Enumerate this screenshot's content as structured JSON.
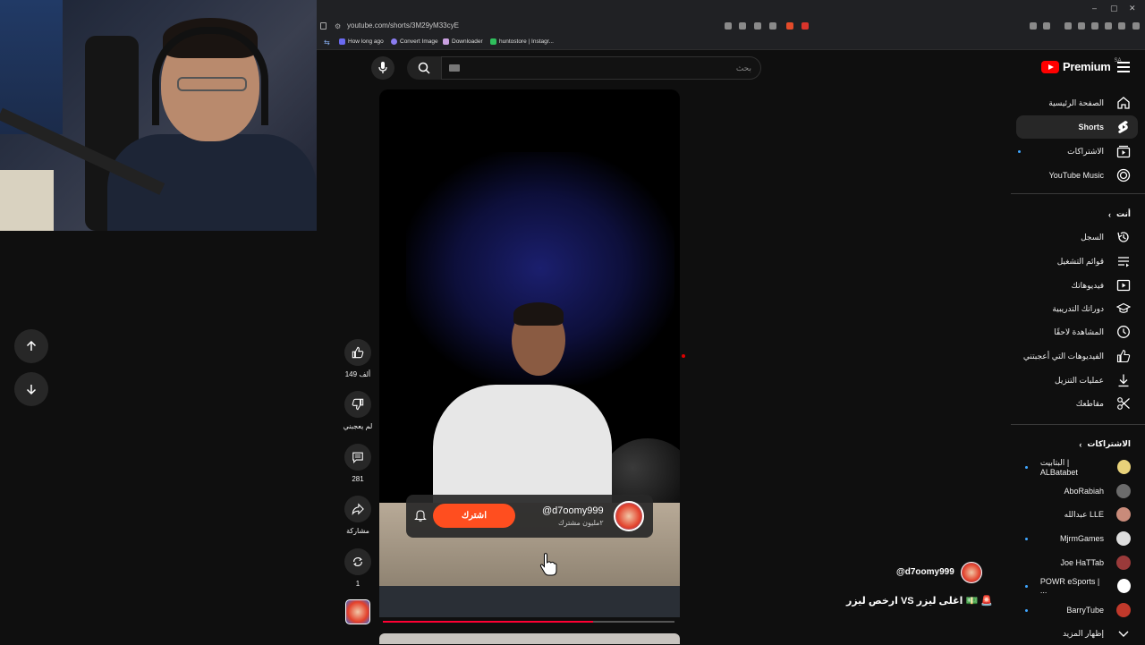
{
  "browser": {
    "url": "youtube.com/shorts/3M29yM33cyE",
    "bookmarks": [
      "How long ago",
      "Convert Image",
      "Downloader",
      "huntostore | Instagr..."
    ],
    "window_controls": [
      "–",
      "▢",
      "✕"
    ]
  },
  "header": {
    "logo_text": "Premium",
    "logo_region": "SA",
    "search_placeholder": "بحث"
  },
  "sidebar": {
    "main": [
      {
        "label": "الصفحة الرئيسية",
        "icon": "home-icon"
      },
      {
        "label": "Shorts",
        "icon": "shorts-icon",
        "active": true
      },
      {
        "label": "الاشتراكات",
        "icon": "subscriptions-icon"
      },
      {
        "label": "YouTube Music",
        "icon": "music-icon"
      }
    ],
    "you_title": "أنت",
    "you": [
      {
        "label": "السجل",
        "icon": "history-icon"
      },
      {
        "label": "قوائم التشغيل",
        "icon": "playlists-icon"
      },
      {
        "label": "فيديوهاتك",
        "icon": "your-videos-icon"
      },
      {
        "label": "دوراتك التدريبية",
        "icon": "courses-icon"
      },
      {
        "label": "المشاهدة لاحقًا",
        "icon": "watch-later-icon"
      },
      {
        "label": "الفيديوهات التي أعجبتني",
        "icon": "liked-icon"
      },
      {
        "label": "عمليات التنزيل",
        "icon": "download-icon"
      },
      {
        "label": "مقاطعك",
        "icon": "clips-icon"
      }
    ],
    "subs_title": "الاشتراكات",
    "subs": [
      {
        "label": "البتابيت | ALBatabet",
        "color": "#e8d27a",
        "live": true
      },
      {
        "label": "AboRabiah",
        "color": "#6b6b6b",
        "live": false
      },
      {
        "label": "عبدالله LLE",
        "color": "#c98b7a",
        "live": false
      },
      {
        "label": "MjrmGames",
        "color": "#dddddd",
        "live": true
      },
      {
        "label": "Joe HaTTab",
        "color": "#9a3a3a",
        "live": false
      },
      {
        "label": "POWR eSports | ...",
        "color": "#ffffff",
        "live": true
      },
      {
        "label": "BarryTube",
        "color": "#c0392b",
        "live": true
      }
    ],
    "show_more": "إظهار المزيد"
  },
  "short": {
    "channel_handle": "@d7oomy999",
    "channel_subs": "٢مليون مشترك",
    "subscribe_label": "اشترك",
    "title": "ارخص ليزر VS اغلى ليزر 💵 🚨",
    "progress": 0.72
  },
  "actions": {
    "likes": "149 ألف",
    "dislike": "لم يعجبني",
    "comments": "281",
    "share": "مشاركة",
    "remix": "1"
  },
  "colors": {
    "accent": "#ff0000",
    "subscribe": "#ff4e1f",
    "progress": "#ff0033"
  }
}
